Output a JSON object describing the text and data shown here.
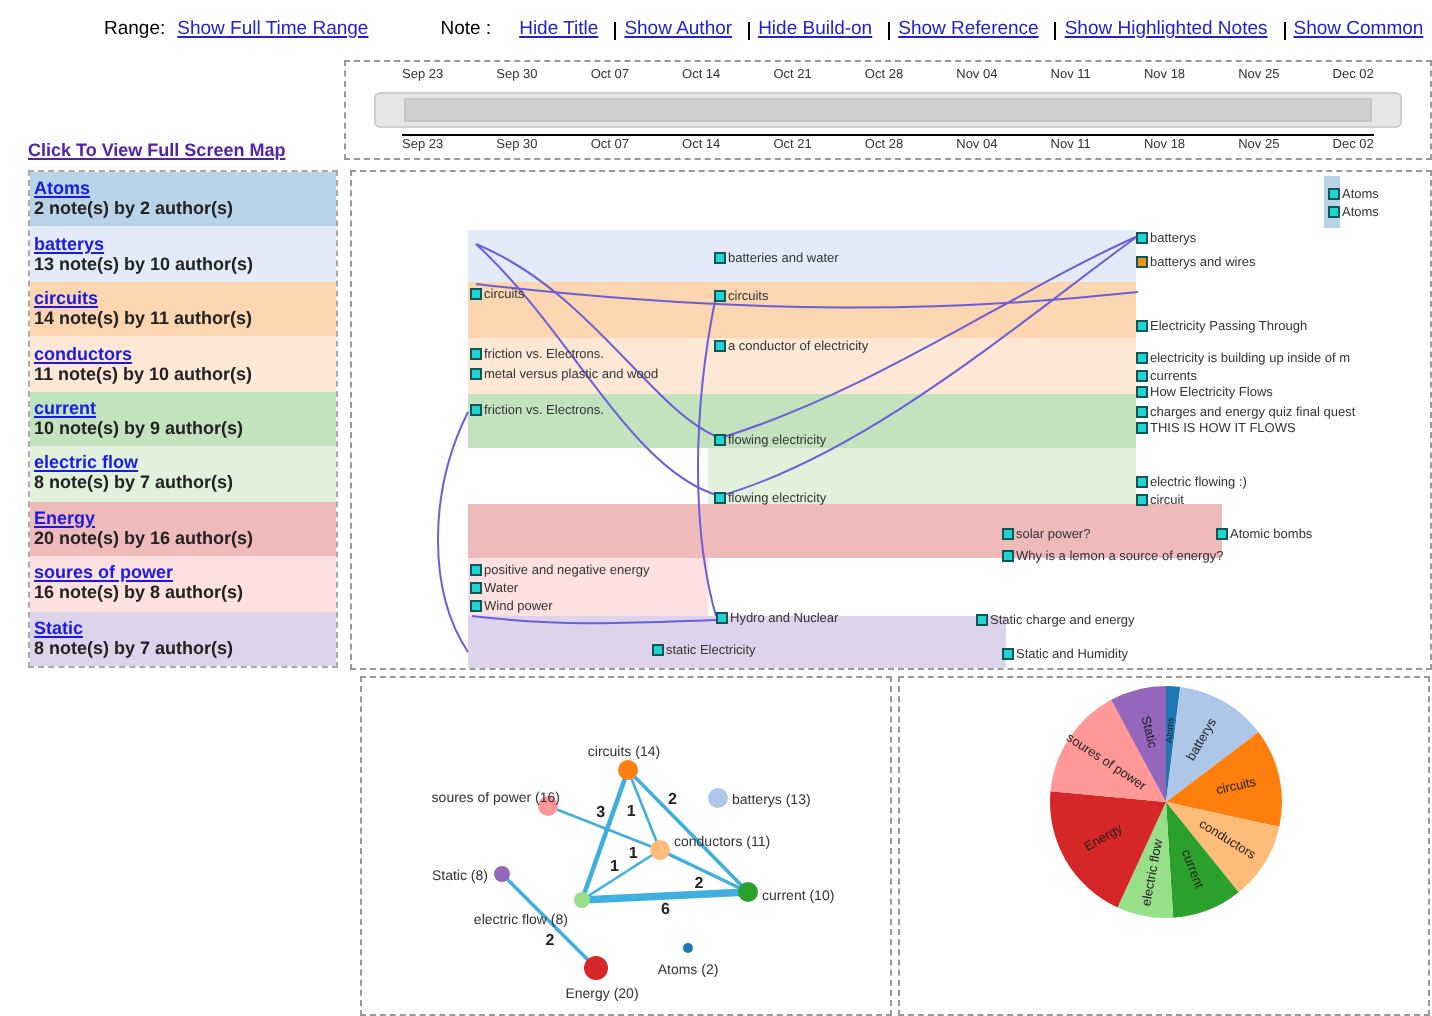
{
  "toolbar": {
    "range_label": "Range:",
    "range_link": "Show Full Time Range",
    "note_label": "Note :",
    "note_links": [
      "Hide Title",
      "Show Author",
      "Hide Build-on",
      "Show Reference",
      "Show Highlighted Notes",
      "Show Common"
    ]
  },
  "timeline": {
    "top_ticks": [
      "Sep 23",
      "Sep 30",
      "Oct 07",
      "Oct 14",
      "Oct 21",
      "Oct 28",
      "Nov 04",
      "Nov 11",
      "Nov 18",
      "Nov 25",
      "Dec 02"
    ],
    "range_slider": {
      "level": 1
    },
    "bottom_ticks": [
      "Sep 23",
      "Sep 30",
      "Oct 07",
      "Oct 14",
      "Oct 21",
      "Oct 28",
      "Nov 04",
      "Nov 11",
      "Nov 18",
      "Nov 25",
      "Dec 02"
    ]
  },
  "full_screen_link": "Click To View Full Screen Map",
  "topics": [
    {
      "name": "Atoms",
      "summary": "2 note(s) by 2 author(s)",
      "color": "#b9d3e8"
    },
    {
      "name": "batterys",
      "summary": "13 note(s) by 10 author(s)",
      "color": "#e2ebf7"
    },
    {
      "name": "circuits",
      "summary": "14 note(s) by 11 author(s)",
      "color": "#fcd6b0"
    },
    {
      "name": "conductors",
      "summary": "11 note(s) by 10 author(s)",
      "color": "#fde8d6"
    },
    {
      "name": "current",
      "summary": "10 note(s) by 9 author(s)",
      "color": "#c3e3bf"
    },
    {
      "name": "electric flow",
      "summary": "8 note(s) by 7 author(s)",
      "color": "#e0f2dc"
    },
    {
      "name": "Energy",
      "summary": "20 note(s) by 16 author(s)",
      "color": "#efbaba"
    },
    {
      "name": "soures of power",
      "summary": "16 note(s) by 8 author(s)",
      "color": "#fde1e1"
    },
    {
      "name": "Static",
      "summary": "8 note(s) by 7 author(s)",
      "color": "#ddd4ec"
    }
  ],
  "map": {
    "notes": [
      {
        "text": "Atoms",
        "highlighted": false
      },
      {
        "text": "Atoms",
        "highlighted": false
      },
      {
        "text": "batterys",
        "highlighted": false
      },
      {
        "text": "batteries and water",
        "highlighted": false
      },
      {
        "text": "batterys and wires",
        "highlighted": true
      },
      {
        "text": "circuits",
        "highlighted": false
      },
      {
        "text": "circuits",
        "highlighted": false
      },
      {
        "text": "Electricity Passing Through",
        "highlighted": false
      },
      {
        "text": "a conductor of electricity",
        "highlighted": false
      },
      {
        "text": "friction vs. Electrons.",
        "highlighted": false
      },
      {
        "text": "electricity is building up inside of m",
        "highlighted": false
      },
      {
        "text": "metal versus plastic and wood",
        "highlighted": false
      },
      {
        "text": "currents",
        "highlighted": false
      },
      {
        "text": "How Electricity Flows",
        "highlighted": false
      },
      {
        "text": "friction vs. Electrons.",
        "highlighted": false
      },
      {
        "text": "charges and energy quiz final quest",
        "highlighted": false
      },
      {
        "text": "THIS IS HOW IT FLOWS",
        "highlighted": false
      },
      {
        "text": "flowing electricity",
        "highlighted": false
      },
      {
        "text": "electric flowing :)",
        "highlighted": false
      },
      {
        "text": "flowing electricity",
        "highlighted": false
      },
      {
        "text": "circuit",
        "highlighted": false
      },
      {
        "text": "solar power?",
        "highlighted": false
      },
      {
        "text": "Atomic bombs",
        "highlighted": false
      },
      {
        "text": "Why is a lemon a source of energy?",
        "highlighted": false
      },
      {
        "text": "positive and negative energy",
        "highlighted": false
      },
      {
        "text": "Water",
        "highlighted": false
      },
      {
        "text": "Wind power",
        "highlighted": false
      },
      {
        "text": "Hydro and Nuclear",
        "highlighted": false
      },
      {
        "text": "Static charge and energy",
        "highlighted": false
      },
      {
        "text": "static Electricity",
        "highlighted": false
      },
      {
        "text": "Static and Humidity",
        "highlighted": false
      }
    ]
  },
  "graph": {
    "nodes": [
      {
        "label": "circuits (14)",
        "color": "#ff7f0e"
      },
      {
        "label": "batterys (13)",
        "color": "#aec7e8"
      },
      {
        "label": "soures of power (16)",
        "color": "#ff9896"
      },
      {
        "label": "conductors (11)",
        "color": "#ffbb78"
      },
      {
        "label": "Static (8)",
        "color": "#9467bd"
      },
      {
        "label": "electric flow (8)",
        "color": "#98df8a"
      },
      {
        "label": "current (10)",
        "color": "#2ca02c"
      },
      {
        "label": "Atoms (2)",
        "color": "#1f77b4"
      },
      {
        "label": "Energy (20)",
        "color": "#d62728"
      }
    ],
    "edges": [
      {
        "label": "3"
      },
      {
        "label": "1"
      },
      {
        "label": "2"
      },
      {
        "label": "2"
      },
      {
        "label": "1"
      },
      {
        "label": "6"
      },
      {
        "label": "1"
      },
      {
        "label": "2"
      }
    ]
  },
  "pie": {
    "chart_data": {
      "type": "pie",
      "categories": [
        "Atoms",
        "batterys",
        "circuits",
        "conductors",
        "current",
        "electric flow",
        "Energy",
        "soures of power",
        "Static"
      ],
      "values": [
        2,
        13,
        14,
        11,
        10,
        8,
        20,
        16,
        8
      ]
    }
  }
}
